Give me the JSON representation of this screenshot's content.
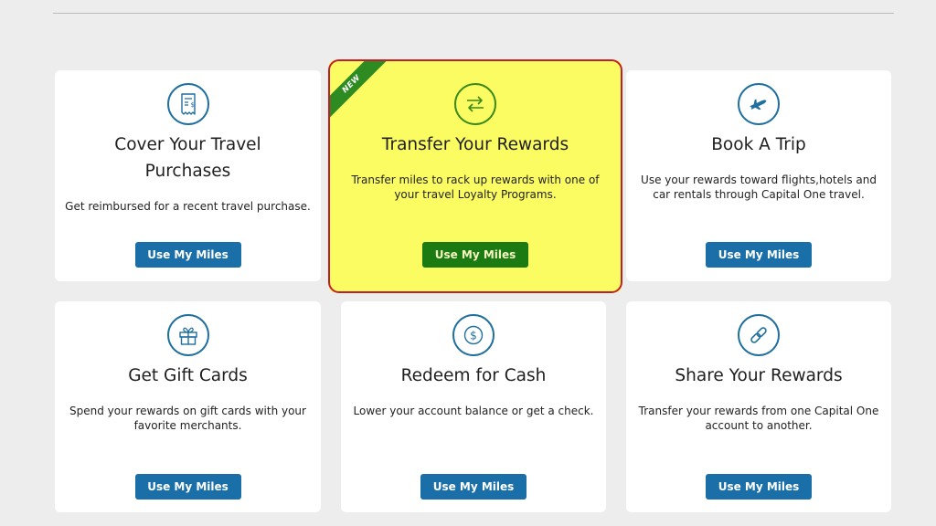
{
  "cards": [
    {
      "title_line1": "Cover Your Travel",
      "title_line2": "Purchases",
      "description_line1": "Get reimbursed for a recent travel purchase.",
      "description_line2": "",
      "button_label": "Use My Miles",
      "icon": "receipt-icon"
    },
    {
      "badge": "NEW",
      "title_line1": "Transfer Your Rewards",
      "description_line1": "Transfer miles to rack up rewards with one of",
      "description_line2": "your travel Loyalty Programs.",
      "button_label": "Use My Miles",
      "icon": "transfer-arrows-icon",
      "highlighted": true
    },
    {
      "title_line1": "Book A Trip",
      "description_line1": "Use your rewards toward flights,hotels and",
      "description_line2": "car rentals through Capital One travel.",
      "button_label": "Use My Miles",
      "icon": "airplane-icon"
    },
    {
      "title_line1": "Get Gift Cards",
      "description_line1": "Spend your rewards on gift cards with your",
      "description_line2": "favorite merchants.",
      "button_label": "Use My Miles",
      "icon": "gift-icon"
    },
    {
      "title_line1": "Redeem for Cash",
      "description_line1": "Lower your account balance or get a check.",
      "description_line2": "",
      "button_label": "Use My Miles",
      "icon": "dollar-coin-icon"
    },
    {
      "title_line1": "Share Your Rewards",
      "description_line1": "Transfer your rewards from one Capital One",
      "description_line2": "account to another.",
      "button_label": "Use My Miles",
      "icon": "link-icon"
    }
  ],
  "colors": {
    "background": "#ededed",
    "card": "#ffffff",
    "button": "#1a6fa8",
    "icon_stroke": "#1f6f9f",
    "highlight_fill": "#fbfb62",
    "highlight_border": "#c0202b",
    "highlight_button": "#1c7a12",
    "new_ribbon": "#2e8b22"
  }
}
